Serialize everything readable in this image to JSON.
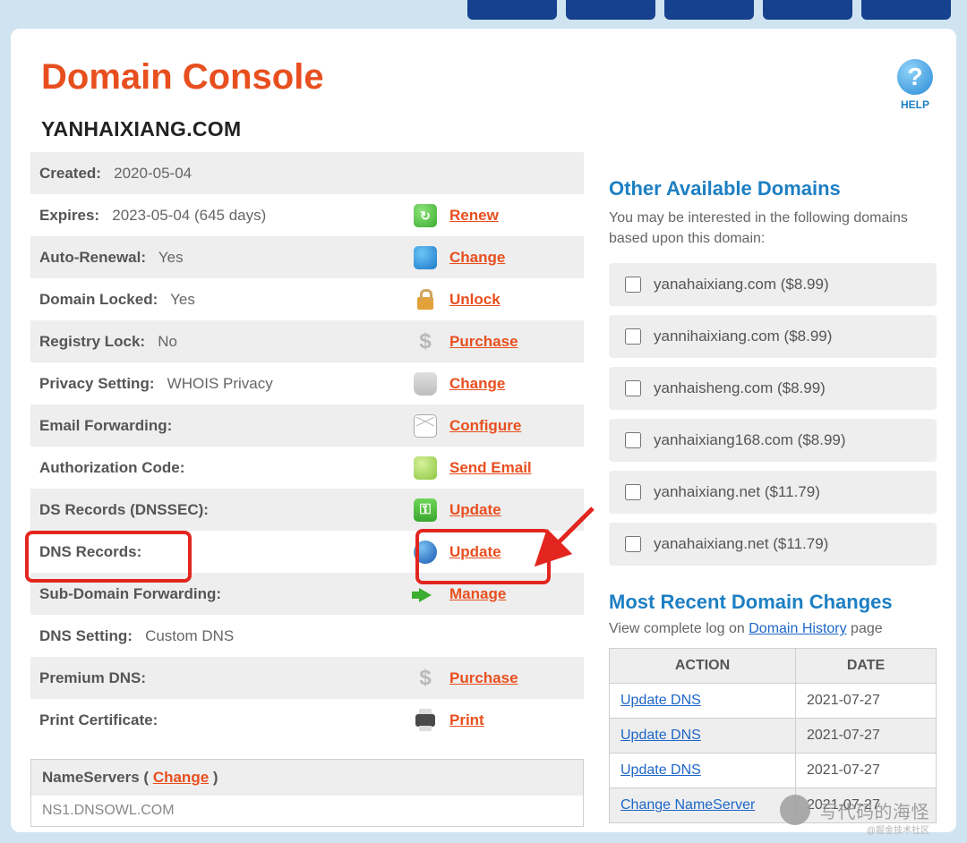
{
  "nav_tabs": [
    "",
    "",
    "",
    "",
    ""
  ],
  "page_title": "Domain Console",
  "help_label": "HELP",
  "domain_name": "YANHAIXIANG.COM",
  "settings_rows": [
    {
      "label": "Created:",
      "value": "2020-05-04",
      "icon": "",
      "iconClass": "",
      "action": ""
    },
    {
      "label": "Expires:",
      "value": "2023-05-04 (645 days)",
      "icon": "↻",
      "iconClass": "renew",
      "action": "Renew"
    },
    {
      "label": "Auto-Renewal:",
      "value": "Yes",
      "icon": "",
      "iconClass": "clock",
      "action": "Change"
    },
    {
      "label": "Domain Locked:",
      "value": "Yes",
      "icon": "",
      "iconClass": "lock",
      "action": "Unlock"
    },
    {
      "label": "Registry Lock:",
      "value": "No",
      "icon": "$",
      "iconClass": "dollar",
      "action": "Purchase"
    },
    {
      "label": "Privacy Setting:",
      "value": "WHOIS Privacy",
      "icon": "",
      "iconClass": "bag",
      "action": "Change"
    },
    {
      "label": "Email Forwarding:",
      "value": "",
      "icon": "",
      "iconClass": "mail",
      "action": "Configure"
    },
    {
      "label": "Authorization Code:",
      "value": "",
      "icon": "",
      "iconClass": "chat",
      "action": "Send Email"
    },
    {
      "label": "DS Records (DNSSEC):",
      "value": "",
      "icon": "⚿",
      "iconClass": "key",
      "action": "Update"
    },
    {
      "label": "DNS Records:",
      "value": "",
      "icon": "",
      "iconClass": "globe",
      "action": "Update"
    },
    {
      "label": "Sub-Domain Forwarding:",
      "value": "",
      "icon": "",
      "iconClass": "arrow",
      "action": "Manage"
    },
    {
      "label": "DNS Setting:",
      "value": "Custom DNS",
      "icon": "",
      "iconClass": "",
      "action": ""
    },
    {
      "label": "Premium DNS:",
      "value": "",
      "icon": "$",
      "iconClass": "dollar",
      "action": "Purchase"
    },
    {
      "label": "Print Certificate:",
      "value": "",
      "icon": "",
      "iconClass": "printer",
      "action": "Print"
    }
  ],
  "ns": {
    "heading": "NameServers",
    "change": "Change",
    "first": "NS1.DNSOWL.COM"
  },
  "right": {
    "alt_heading": "Other Available Domains",
    "alt_desc": "You may be interested in the following domains based upon this domain:",
    "alts": [
      "yanahaixiang.com ($8.99)",
      "yannihaixiang.com ($8.99)",
      "yanhaisheng.com ($8.99)",
      "yanhaixiang168.com ($8.99)",
      "yanhaixiang.net ($11.79)",
      "yanahaixiang.net ($11.79)"
    ],
    "log_heading": "Most Recent Domain Changes",
    "log_pre": "View complete log on ",
    "log_link": "Domain History",
    "log_post": " page",
    "th_action": "ACTION",
    "th_date": "DATE",
    "changes": [
      {
        "action": "Update DNS",
        "date": "2021-07-27"
      },
      {
        "action": "Update DNS",
        "date": "2021-07-27"
      },
      {
        "action": "Update DNS",
        "date": "2021-07-27"
      },
      {
        "action": "Change NameServer",
        "date": "2021-07-27"
      }
    ]
  },
  "watermark": {
    "main": "写代码的海怪",
    "sub": "@掘金技术社区"
  }
}
